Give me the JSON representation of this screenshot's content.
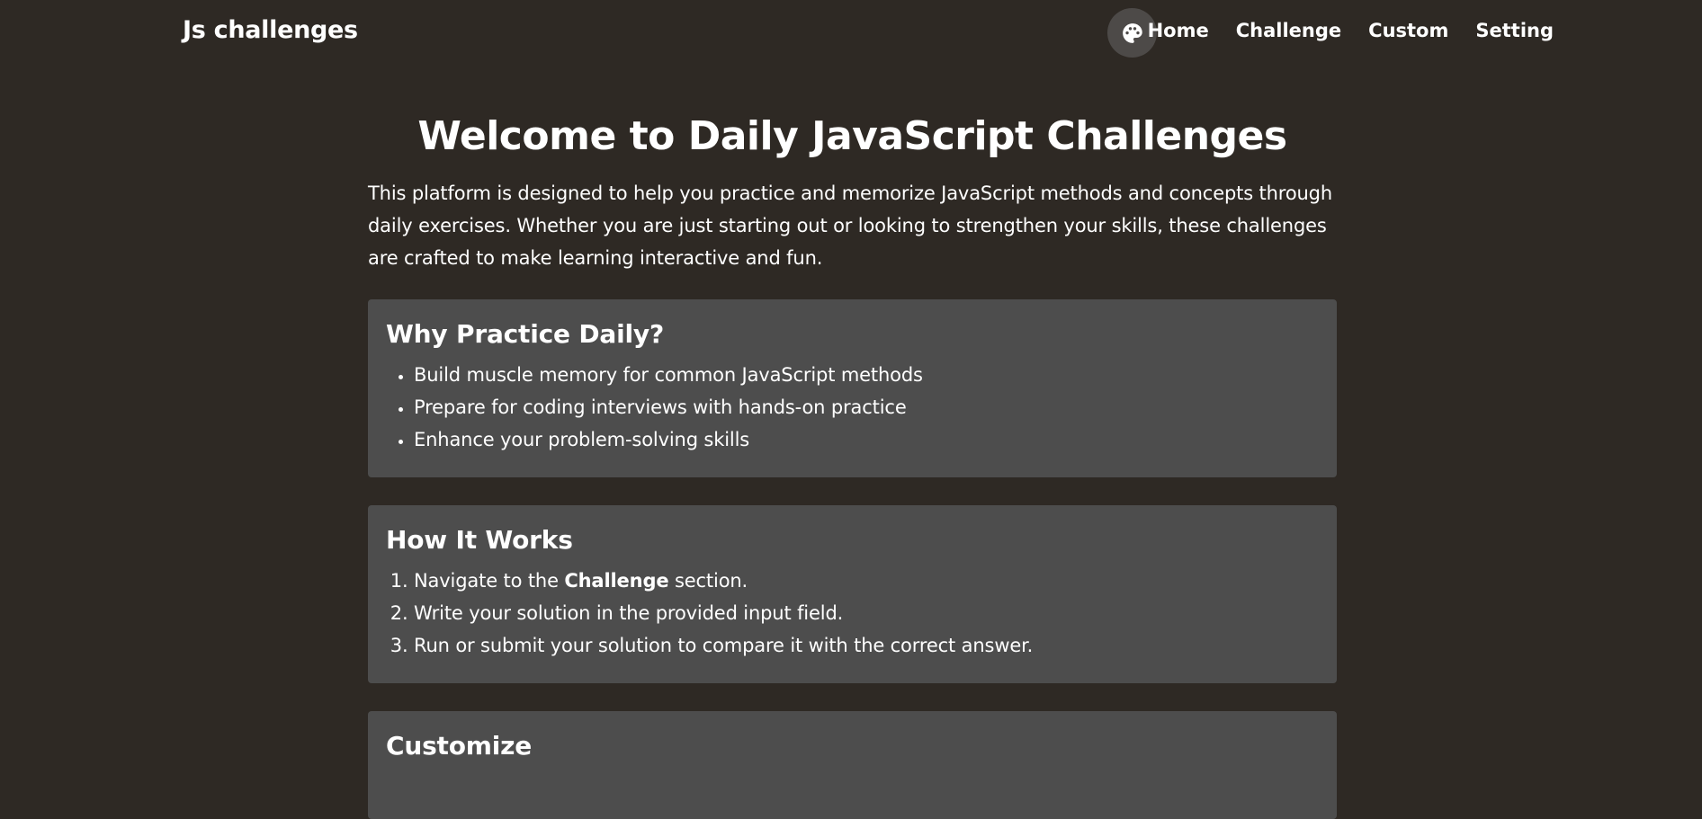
{
  "header": {
    "brand": "Js challenges",
    "theme_icon": "palette-icon",
    "nav": [
      {
        "label": "Home"
      },
      {
        "label": "Challenge"
      },
      {
        "label": "Custom"
      },
      {
        "label": "Setting"
      }
    ]
  },
  "main": {
    "title": "Welcome to Daily JavaScript Challenges",
    "intro": "This platform is designed to help you practice and memorize JavaScript methods and concepts through daily exercises. Whether you are just starting out or looking to strengthen your skills, these challenges are crafted to make learning interactive and fun.",
    "why": {
      "title": "Why Practice Daily?",
      "items": [
        "Build muscle memory for common JavaScript methods",
        "Prepare for coding interviews with hands-on practice",
        "Enhance your problem-solving skills"
      ]
    },
    "how": {
      "title": "How It Works",
      "step1_prefix": "Navigate to the ",
      "step1_bold": "Challenge",
      "step1_suffix": " section.",
      "step2": "Write your solution in the provided input field.",
      "step3": "Run or submit your solution to compare it with the correct answer."
    },
    "customize": {
      "title": "Customize"
    }
  },
  "colors": {
    "background": "#2e2924",
    "card": "#4d4d4d",
    "theme_button": "#4d4a48",
    "text": "#ffffff"
  }
}
